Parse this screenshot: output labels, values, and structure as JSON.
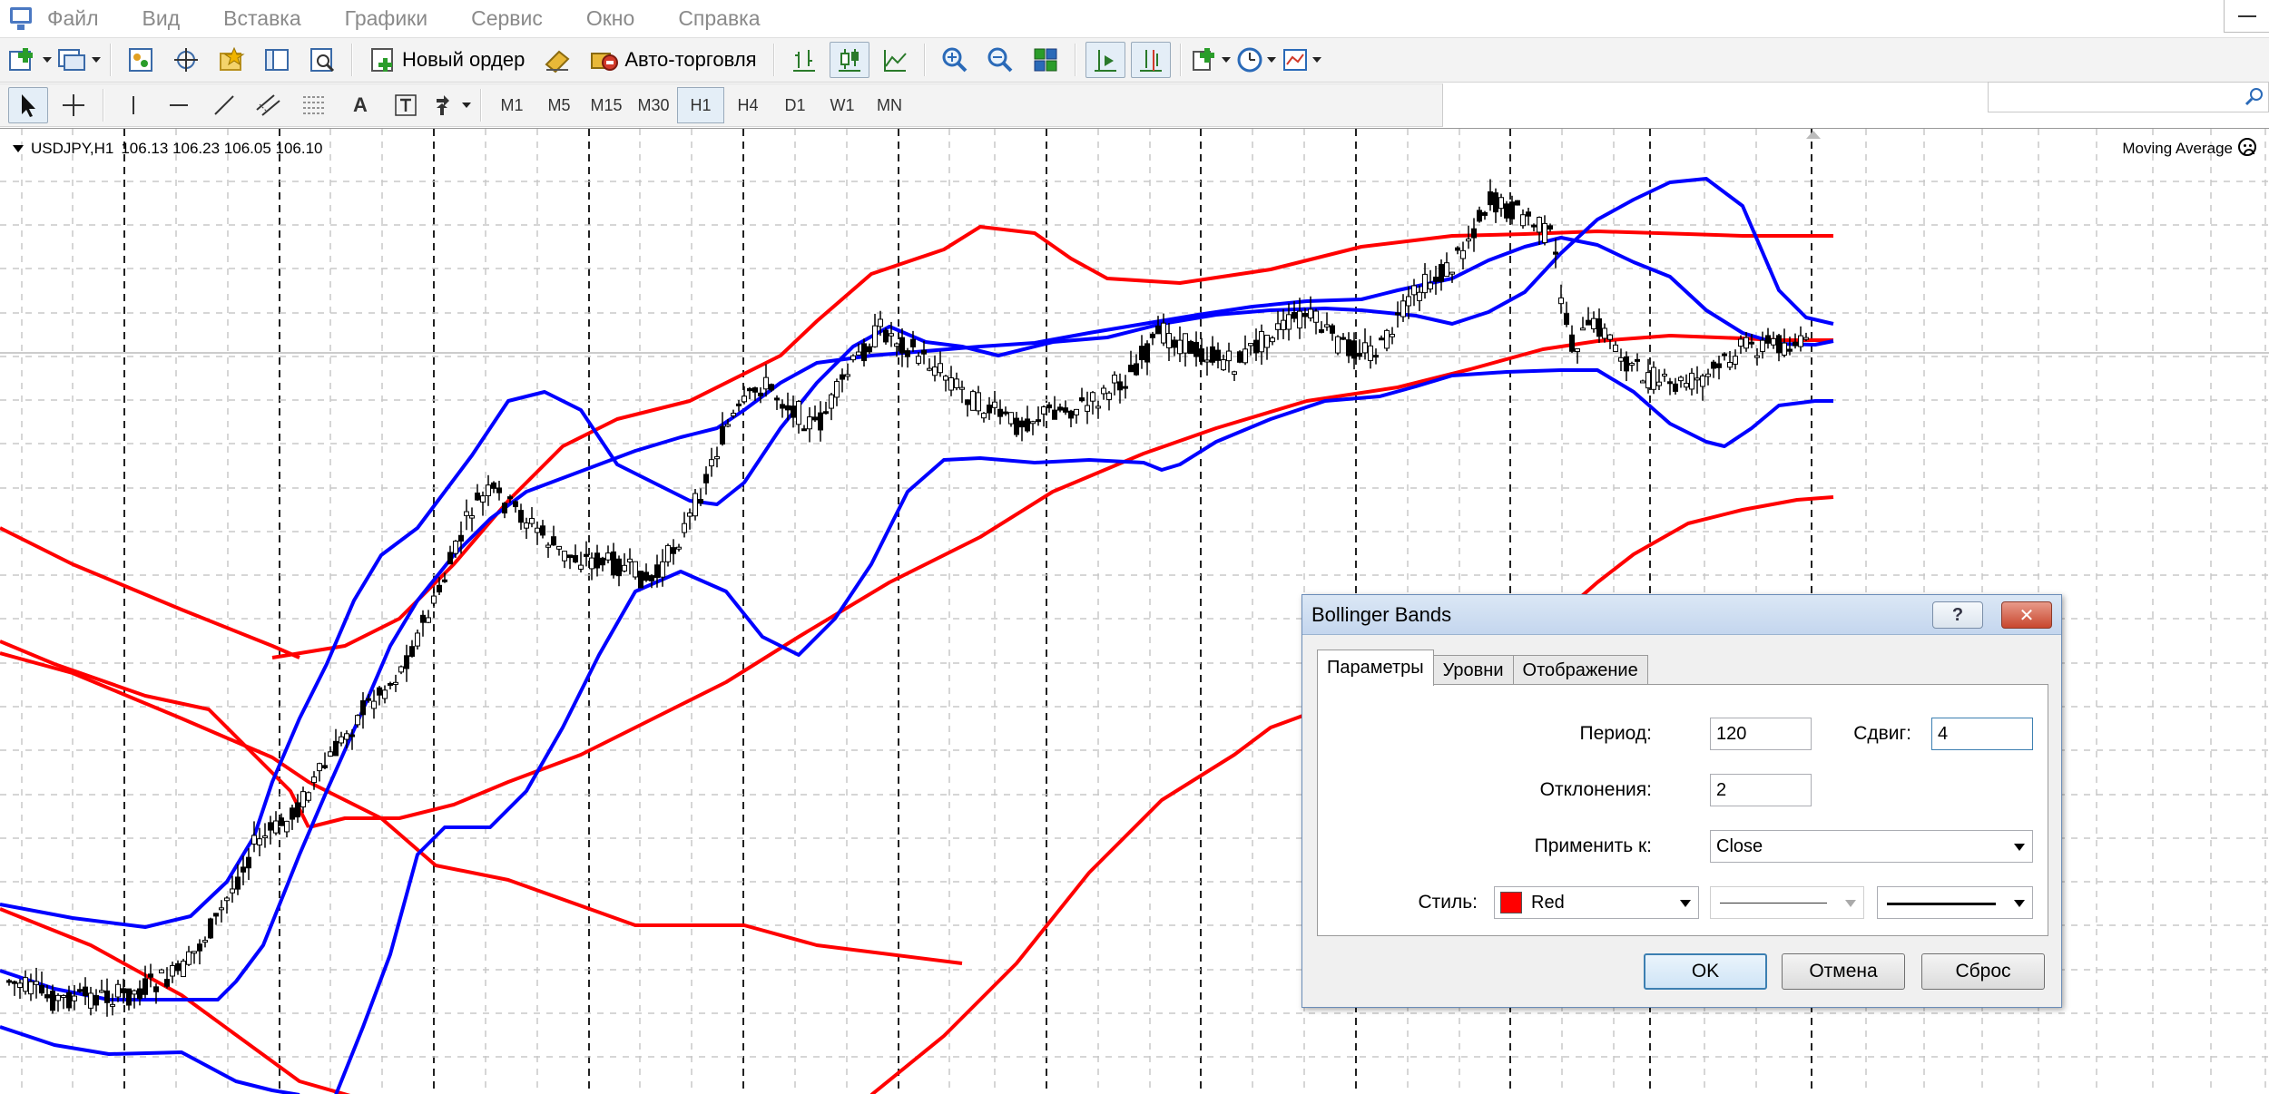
{
  "menu": [
    "Файл",
    "Вид",
    "Вставка",
    "Графики",
    "Сервис",
    "Окно",
    "Справка"
  ],
  "toolbar": {
    "new_order_label": "Новый ордер",
    "auto_trading_label": "Авто-торговля",
    "search_placeholder": ""
  },
  "drawing_toolbar": {
    "text_tool_label": "A",
    "timeframes": [
      "M1",
      "M5",
      "M15",
      "M30",
      "H1",
      "H4",
      "D1",
      "W1",
      "MN"
    ],
    "active_timeframe": "H1"
  },
  "chart": {
    "symbol": "USDJPY,H1",
    "ohlc": "106.13 106.23 106.05 106.10",
    "indicator_label": "Moving Average",
    "colors": {
      "bands_red": "#ff0000",
      "bands_blue": "#0000ff",
      "candles": "#000000",
      "grid": "#c8c8c8"
    }
  },
  "dialog": {
    "title": "Bollinger Bands",
    "help_label": "?",
    "close_label": "✕",
    "tabs": [
      "Параметры",
      "Уровни",
      "Отображение"
    ],
    "active_tab": "Параметры",
    "fields": {
      "period_label": "Период:",
      "period_value": "120",
      "shift_label": "Сдвиг:",
      "shift_value": "4",
      "deviation_label": "Отклонения:",
      "deviation_value": "2",
      "apply_label": "Применить к:",
      "apply_value": "Close",
      "style_label": "Стиль:",
      "color_value": "Red",
      "color_hex": "#ff0000"
    },
    "buttons": {
      "ok": "OK",
      "cancel": "Отмена",
      "reset": "Сброс"
    }
  }
}
